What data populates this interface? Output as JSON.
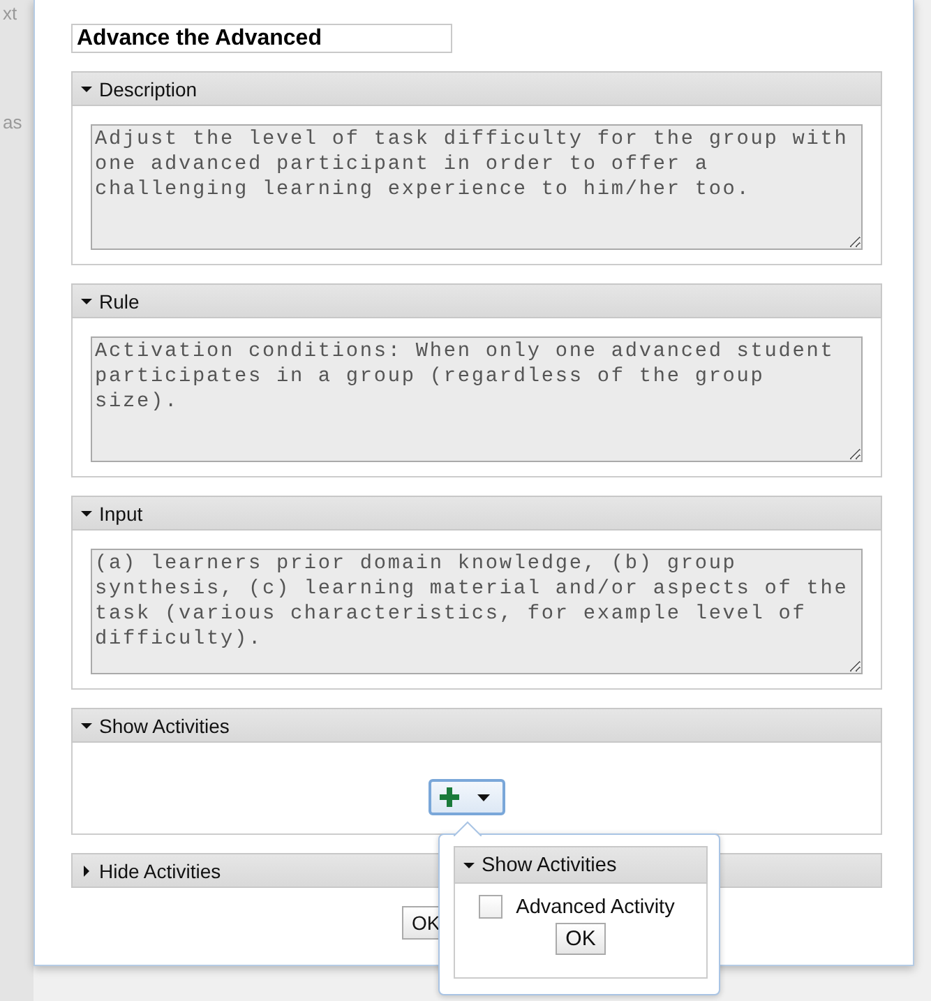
{
  "background": {
    "fragments": [
      "xt",
      "as"
    ]
  },
  "dialog": {
    "title_value": "Advance the Advanced",
    "panels": [
      {
        "kind": "text",
        "title": "Description",
        "expanded": true,
        "text": "Adjust the level of task difficulty for the group with one advanced participant in order to offer a challenging learning experience to him/her too."
      },
      {
        "kind": "text",
        "title": "Rule",
        "expanded": true,
        "text": "Activation conditions: When only one advanced student participates in a group (regardless of the group size)."
      },
      {
        "kind": "text",
        "title": "Input",
        "expanded": true,
        "text": "(a) learners prior domain knowledge, (b) group synthesis, (c) learning material and/or aspects of the task (various characteristics, for example level of difficulty)."
      },
      {
        "kind": "activities",
        "title": "Show Activities",
        "expanded": true
      },
      {
        "title": "Hide Activities",
        "expanded": false
      }
    ],
    "ok_label": "OK"
  },
  "popover": {
    "panel_title": "Show Activities",
    "expanded": true,
    "options": [
      {
        "label": "Advanced Activity",
        "checked": false
      }
    ],
    "ok_label": "OK"
  }
}
